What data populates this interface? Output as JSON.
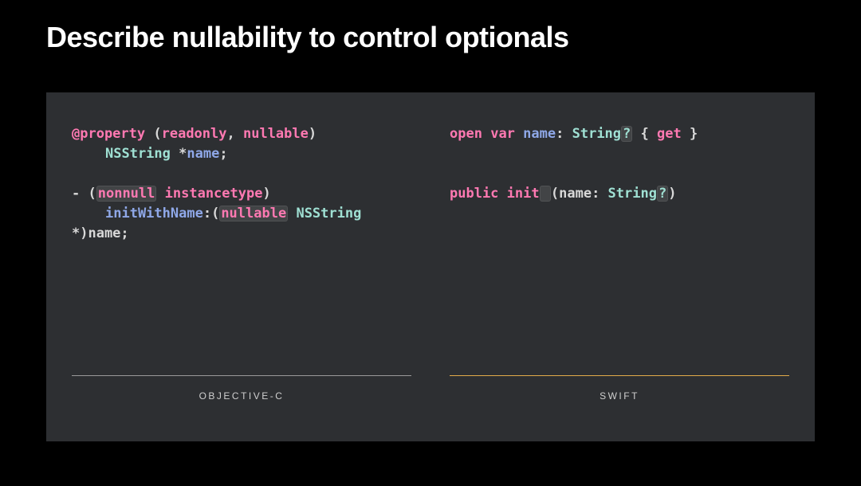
{
  "title": "Describe nullability to control optionals",
  "labels": {
    "left": "OBJECTIVE-C",
    "right": "SWIFT"
  },
  "colors": {
    "keyword": "#ff79b2",
    "type": "#9fe0d3",
    "identifier": "#8fa8e8",
    "highlight_bg": "rgba(255,255,255,0.10)",
    "left_rule": "#9a9a9a",
    "right_rule": "#e3ab4a"
  },
  "objc_tokens": {
    "at_property": "@property",
    "open_paren": " (",
    "readonly": "readonly",
    "comma_sp": ", ",
    "nullable": "nullable",
    "close_paren": ")",
    "nsstring": "NSString",
    "star_name_semi": " *name;",
    "star": " *",
    "name": "name",
    "semi": ";",
    "dash_sp": "- ",
    "lparen": "(",
    "nonnull": "nonnull",
    "sp": " ",
    "instancetype": "instancetype",
    "rparen": ")",
    "initWithName": "initWithName",
    "colon_lparen": ":(",
    "rparen_name_semi": " *)name;"
  },
  "swift_tokens": {
    "open": "open",
    "var": "var",
    "name": "name",
    "colon_sp": ": ",
    "string": "String",
    "qmark": "?",
    "sp": " ",
    "lbrace": "{ ",
    "get": "get",
    "rbrace": " }",
    "public": "public",
    "init": "init",
    "lparen": "(",
    "rparen": ")",
    "name_colon_sp": "name: "
  }
}
